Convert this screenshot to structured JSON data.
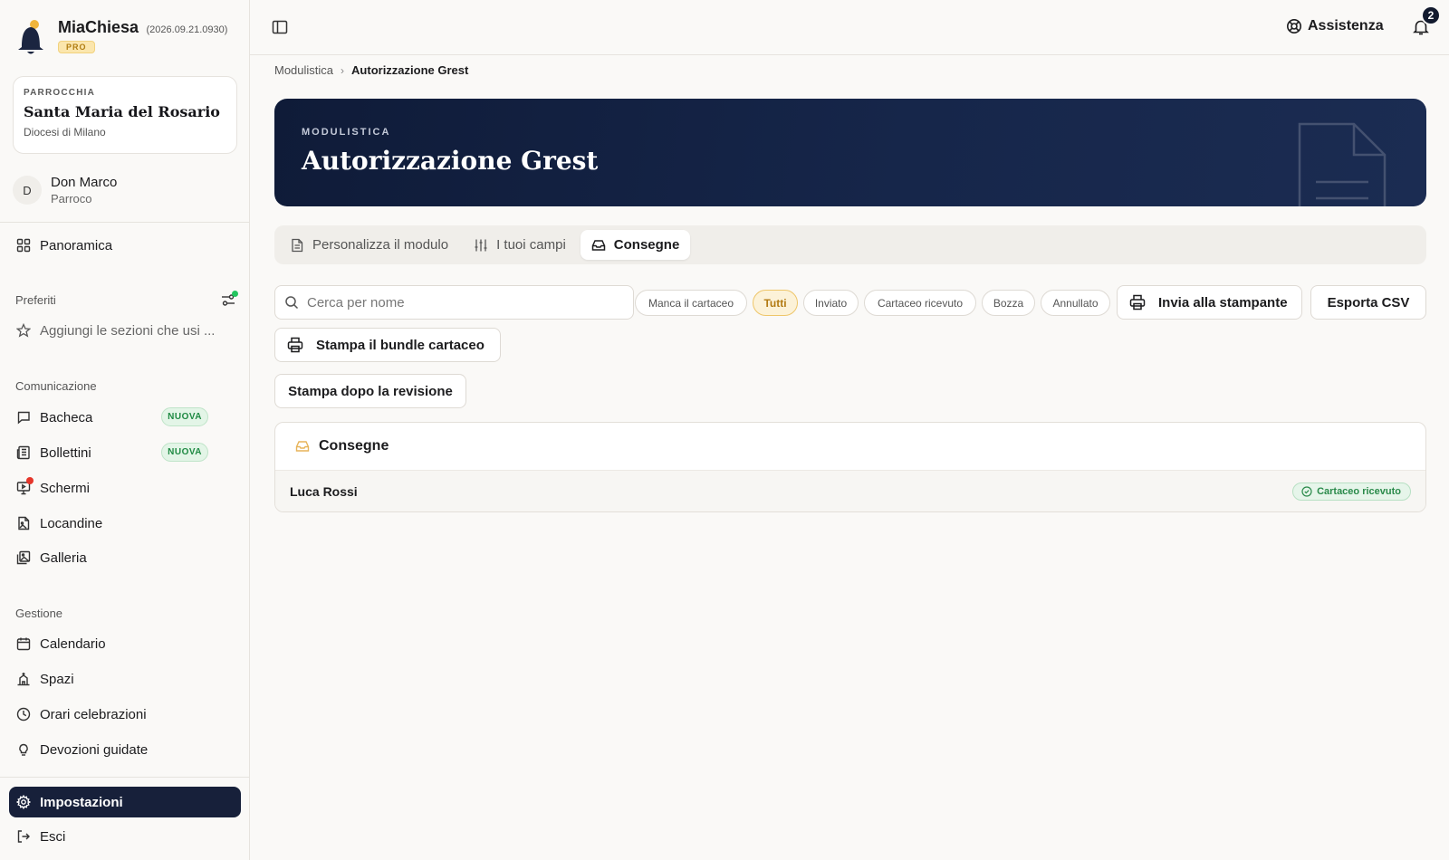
{
  "brand": {
    "name": "MiaChiesa",
    "version": "(2026.09.21.0930)",
    "plan": "PRO"
  },
  "parish": {
    "kicker": "PARROCCHIA",
    "name": "Santa Maria del Rosario",
    "diocese": "Diocesi di Milano"
  },
  "user": {
    "initial": "D",
    "name": "Don Marco",
    "role": "Parroco"
  },
  "nav": {
    "overview": "Panoramica",
    "favorites_label": "Preferiti",
    "favorites_hint": "Aggiungi le sezioni che usi ...",
    "communication_label": "Comunicazione",
    "communication": [
      {
        "label": "Bacheca",
        "badge": "NUOVA"
      },
      {
        "label": "Bollettini",
        "badge": "NUOVA"
      },
      {
        "label": "Schermi"
      },
      {
        "label": "Locandine"
      },
      {
        "label": "Galleria"
      }
    ],
    "management_label": "Gestione",
    "management": [
      {
        "label": "Calendario"
      },
      {
        "label": "Spazi"
      },
      {
        "label": "Orari celebrazioni"
      },
      {
        "label": "Devozioni guidate"
      }
    ],
    "settings": "Impostazioni",
    "logout": "Esci"
  },
  "topbar": {
    "help_label": "Assistenza",
    "notification_count": "2"
  },
  "breadcrumb": {
    "parent": "Modulistica",
    "current": "Autorizzazione Grest"
  },
  "hero": {
    "kicker": "MODULISTICA",
    "title": "Autorizzazione Grest"
  },
  "tabs": [
    {
      "label": "Personalizza il modulo",
      "icon": "document-icon"
    },
    {
      "label": "I tuoi campi",
      "icon": "sliders-icon"
    },
    {
      "label": "Consegne",
      "icon": "inbox-icon",
      "active": true
    }
  ],
  "search": {
    "placeholder": "Cerca per nome",
    "value": ""
  },
  "filters": [
    "Manca il cartaceo",
    "Tutti",
    "Inviato",
    "Cartaceo ricevuto",
    "Bozza",
    "Annullato"
  ],
  "active_filter": "Tutti",
  "actions": {
    "send_to_printer": "Invia alla stampante",
    "export_csv": "Esporta CSV",
    "print_bundle": "Stampa il bundle cartaceo",
    "print_after_review": "Stampa dopo la revisione"
  },
  "deliveries": {
    "title": "Consegne",
    "rows": [
      {
        "name": "Luca Rossi",
        "status": "Cartaceo ricevuto"
      }
    ]
  },
  "colors": {
    "accent_dark": "#17203a",
    "hero_bg": "#0f1b38",
    "new_badge": "#1f8a43",
    "filter_active": "#b27a12",
    "status_received": "#2a8a4a"
  }
}
